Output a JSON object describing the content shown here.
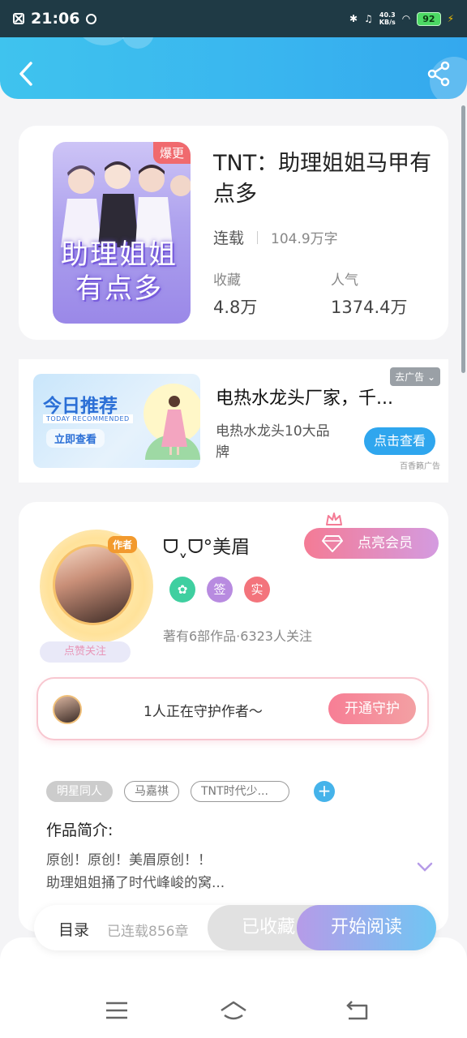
{
  "status_bar": {
    "time": "21:06",
    "net_speed_value": "40.3",
    "net_speed_unit": "KB/s",
    "battery": "92"
  },
  "book": {
    "badge": "爆更",
    "cover_text_line1": "助理姐姐",
    "cover_text_line2": "有点多",
    "title": "TNT：助理姐姐马甲有点多",
    "status": "连载",
    "word_count": "104.9万字",
    "favorites_label": "收藏",
    "favorites_value": "4.8万",
    "popularity_label": "人气",
    "popularity_value": "1374.4万"
  },
  "ad": {
    "image_title": "今日推荐",
    "image_subtitle": "TODAY RECOMMENDED",
    "image_cta": "立即查看",
    "title": "电热水龙头厂家，千...",
    "description": "电热水龙头10大品牌",
    "cta": "点击查看",
    "close_label": "去广告",
    "source": "百香籁广告"
  },
  "author": {
    "avatar_tag": "作者",
    "follow_label": "点赞关注",
    "name": "ᗜˬᗜ°美眉",
    "vip_label": "点亮会员",
    "badges": [
      {
        "label": "",
        "color": "#3fcfa0"
      },
      {
        "label": "签",
        "color": "#b88be0"
      },
      {
        "label": "实",
        "color": "#f3747c"
      }
    ],
    "meta": "著有6部作品·6323人关注",
    "guard_text": "1人正在守护作者～",
    "guard_button": "开通守护"
  },
  "tags": [
    "明星同人",
    "马嘉祺",
    "TNT时代少..."
  ],
  "intro": {
    "title": "作品简介:",
    "line1": "原创！原创！美眉原创！！",
    "line2": "助理姐姐捅了时代峰峻的窝..."
  },
  "bottom_bar": {
    "toc_label": "目录",
    "chapters": "已连载856章",
    "collected_label": "已收藏",
    "read_label": "开始阅读"
  },
  "colors": {
    "header_blue": "#39b5ef",
    "accent_pink": "#f47b95",
    "accent_purple": "#b69be8"
  }
}
